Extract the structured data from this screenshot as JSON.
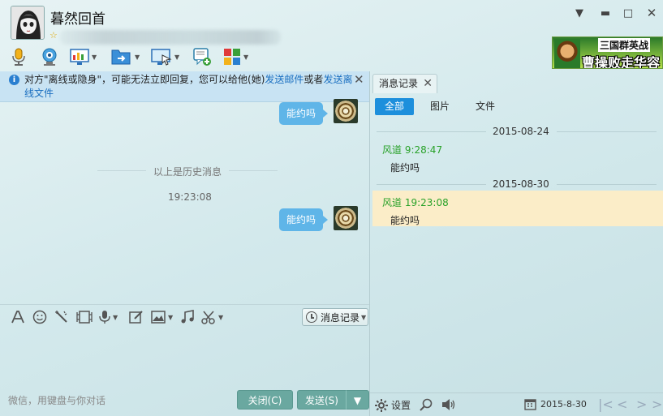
{
  "window": {
    "contact_name": "暮然回首",
    "controls": {
      "menu": "▼",
      "minimize": "▬",
      "maximize": "□",
      "close": "✕"
    }
  },
  "ad": {
    "line1": "三国群英战",
    "line2": "曹操败走华容"
  },
  "toolbar": {
    "icons": [
      "microphone-icon",
      "video-call-icon",
      "remote-desktop-icon",
      "file-transfer-icon",
      "screen-share-icon",
      "send-sms-icon",
      "apps-icon"
    ]
  },
  "notice": {
    "text_prefix": "对方\"离线或隐身\"，可能无法立即回复，您可以给他(她)",
    "link_email": "发送邮件",
    "text_mid": "或者",
    "link_offline_file": "发送离线文件"
  },
  "chat": {
    "messages": [
      {
        "text": "能约吗"
      },
      {
        "text": "能约吗"
      }
    ],
    "history_divider": "以上是历史消息",
    "timestamp": "19:23:08"
  },
  "input": {
    "placeholder": "微信，用键盘与你对话",
    "history_button": "消息记录",
    "close_button": "关闭(C)",
    "send_button": "发送(S)"
  },
  "history_panel": {
    "tab_label": "消息记录",
    "filters": [
      "全部",
      "图片",
      "文件"
    ],
    "groups": [
      {
        "date": "2015-08-24",
        "sender": "风道 9:28:47",
        "message": "能约吗"
      },
      {
        "date": "2015-08-30",
        "sender": "风道 19:23:08",
        "message": "能约吗"
      }
    ],
    "footer": {
      "settings_label": "设置",
      "date": "2015-8-30"
    }
  },
  "colors": {
    "bubble": "#5fb5e8",
    "accent": "#1d8fdc",
    "sender": "#2aa22a",
    "highlight": "#fbedc8"
  }
}
